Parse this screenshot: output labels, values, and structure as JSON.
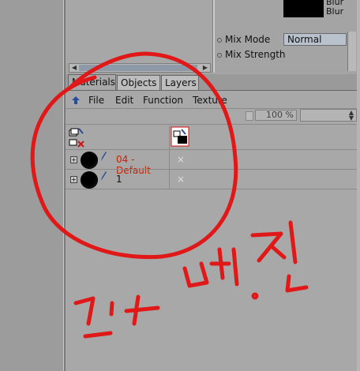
{
  "attributes": {
    "blur_labels": [
      "Blur",
      "Blur"
    ],
    "mix_mode_label": "Mix Mode",
    "mix_mode_value": "Normal",
    "mix_strength_label": "Mix Strength"
  },
  "tabs": [
    {
      "label": "Materials",
      "active": true
    },
    {
      "label": "Objects",
      "active": false
    },
    {
      "label": "Layers",
      "active": false
    }
  ],
  "menu": [
    "File",
    "Edit",
    "Function",
    "Texture"
  ],
  "zoom": "100 %",
  "materials": [
    {
      "name": "04 - Default",
      "color": "#cc2200",
      "tag": "×"
    },
    {
      "name": "1",
      "color": "#111111",
      "tag": "×"
    }
  ],
  "annotation": {
    "color": "#e01818",
    "text": "고무 벗진"
  }
}
